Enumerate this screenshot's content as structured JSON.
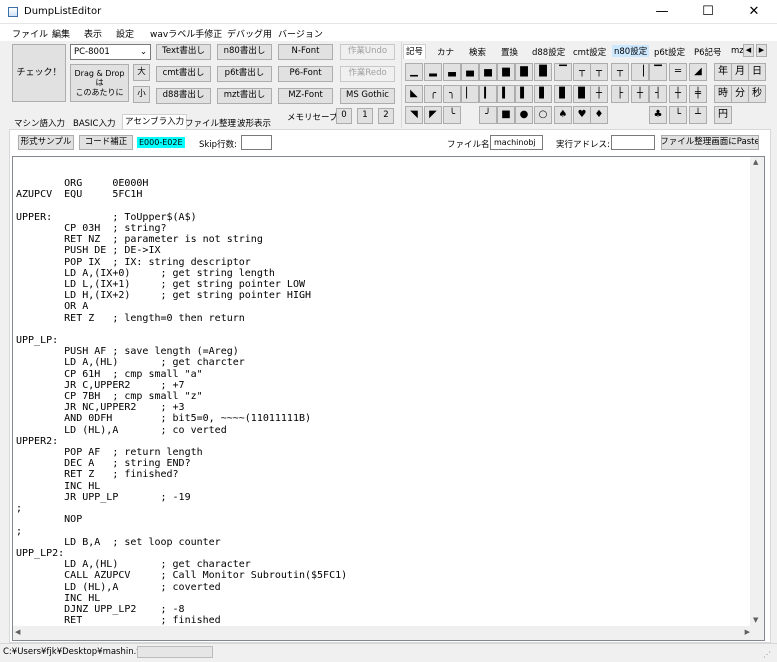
{
  "window": {
    "title": "DumpListEditor",
    "minimize_glyph": "—",
    "maximize_glyph": "☐",
    "close_glyph": "✕"
  },
  "menu": [
    "ファイル",
    "編集",
    "表示",
    "設定",
    "wavラベル手修正",
    "デバッグ用",
    "バージョン"
  ],
  "toolbar": {
    "check_button": "チェック！",
    "machine_select": "PC-8001",
    "drag_drop_label": "Drag & Drop\nは\nこのあたりに",
    "size_large": "大",
    "size_small": "小",
    "export_buttons": [
      "Text書出し",
      "cmt書出し",
      "d88書出し",
      "n80書出し",
      "p6t書出し",
      "mzt書出し"
    ],
    "font_buttons": [
      "N-Font",
      "P6-Font",
      "MZ-Font"
    ],
    "undo_button": "作業Undo",
    "redo_button": "作業Redo",
    "gothic_button": "MS Gothic",
    "memory_save_label": "メモリセーブ:",
    "memory_slots": [
      "0",
      "1",
      "2"
    ]
  },
  "glyph_panel": {
    "tabs": [
      "記号",
      "カナ",
      "検索",
      "置換",
      "d88設定",
      "cmt設定",
      "n80設定",
      "p6t設定",
      "P6記号",
      "mz"
    ],
    "selected_tab": "記号",
    "scroll_left": "◀",
    "scroll_right": "▶",
    "glyphs": [
      "▁",
      "▂",
      "▃",
      "▄",
      "▅",
      "▆",
      "▇",
      "█",
      "▔",
      "┬",
      "┬",
      "┬",
      "▕",
      "▔",
      "═",
      "◢",
      "◣",
      "╭",
      "╮",
      "▏",
      "▎",
      "▍",
      "▌",
      "▋",
      "▊",
      "▉",
      "┼",
      "├",
      "┼",
      "┤",
      "┼",
      "╪",
      "◥",
      "◤",
      "╰",
      "╯",
      "■",
      "●",
      "○",
      "♠",
      "♥",
      "♦",
      "♣",
      "└",
      "┴",
      "┘",
      "╲",
      "╱",
      "╳"
    ],
    "kanji_glyphs": [
      "年",
      "月",
      "日",
      "時",
      "分",
      "秒",
      "円"
    ]
  },
  "tabs": {
    "items": [
      "マシン語入力",
      "BASIC入力",
      "アセンブラ入力",
      "ファイル整理",
      "波形表示"
    ],
    "selected": "アセンブラ入力"
  },
  "assembler_bar": {
    "format_sample_button": "形式サンプル",
    "code_fix_button": "コード補正",
    "address_range": "E000-E02E",
    "skip_lines_label": "Skip行数:",
    "skip_lines_value": "",
    "filename_label": "ファイル名:",
    "filename_value": "machinobj",
    "exec_address_label": "実行アドレス:",
    "exec_address_value": "",
    "paste_button": "ファイル整理画面にPaste"
  },
  "editor": {
    "code": "\n        ORG     0E000H\nAZUPCV  EQU     5FC1H\n\nUPPER:          ; ToUpper$(A$)\n        CP 03H  ; string?\n        RET NZ  ; parameter is not string\n        PUSH DE ; DE->IX\n        POP IX  ; IX: string descriptor\n        LD A,(IX+0)     ; get string length\n        LD L,(IX+1)     ; get string pointer LOW\n        LD H,(IX+2)     ; get string pointer HIGH\n        OR A\n        RET Z   ; length=0 then return\n\nUPP_LP:\n        PUSH AF ; save length (=Areg)\n        LD A,(HL)       ; get charcter\n        CP 61H  ; cmp small \"a\"\n        JR C,UPPER2     ; +7\n        CP 7BH  ; cmp small \"z\"\n        JR NC,UPPER2    ; +3\n        AND 0DFH        ; bit5=0, ~~~~(11011111B)\n        LD (HL),A       ; co verted\nUPPER2:\n        POP AF  ; return length\n        DEC A   ; string END?\n        RET Z   ; finished?\n        INC HL\n        JR UPP_LP       ; -19\n;\n        NOP\n;\n        LD B,A  ; set loop counter\nUPP_LP2:\n        LD A,(HL)       ; get character\n        CALL AZUPCV     ; Call Monitor Subroutin($5FC1)\n        LD (HL),A       ; coverted\n        INC HL\n        DJNZ UPP_LP2    ; -8\n        RET             ; finished"
  },
  "status": {
    "path": "C:¥Users¥fjk¥Desktop¥mashin.txt"
  },
  "colors": {
    "address_highlight": "#00ffff",
    "selected_tab_bg": "#cce8ff"
  }
}
